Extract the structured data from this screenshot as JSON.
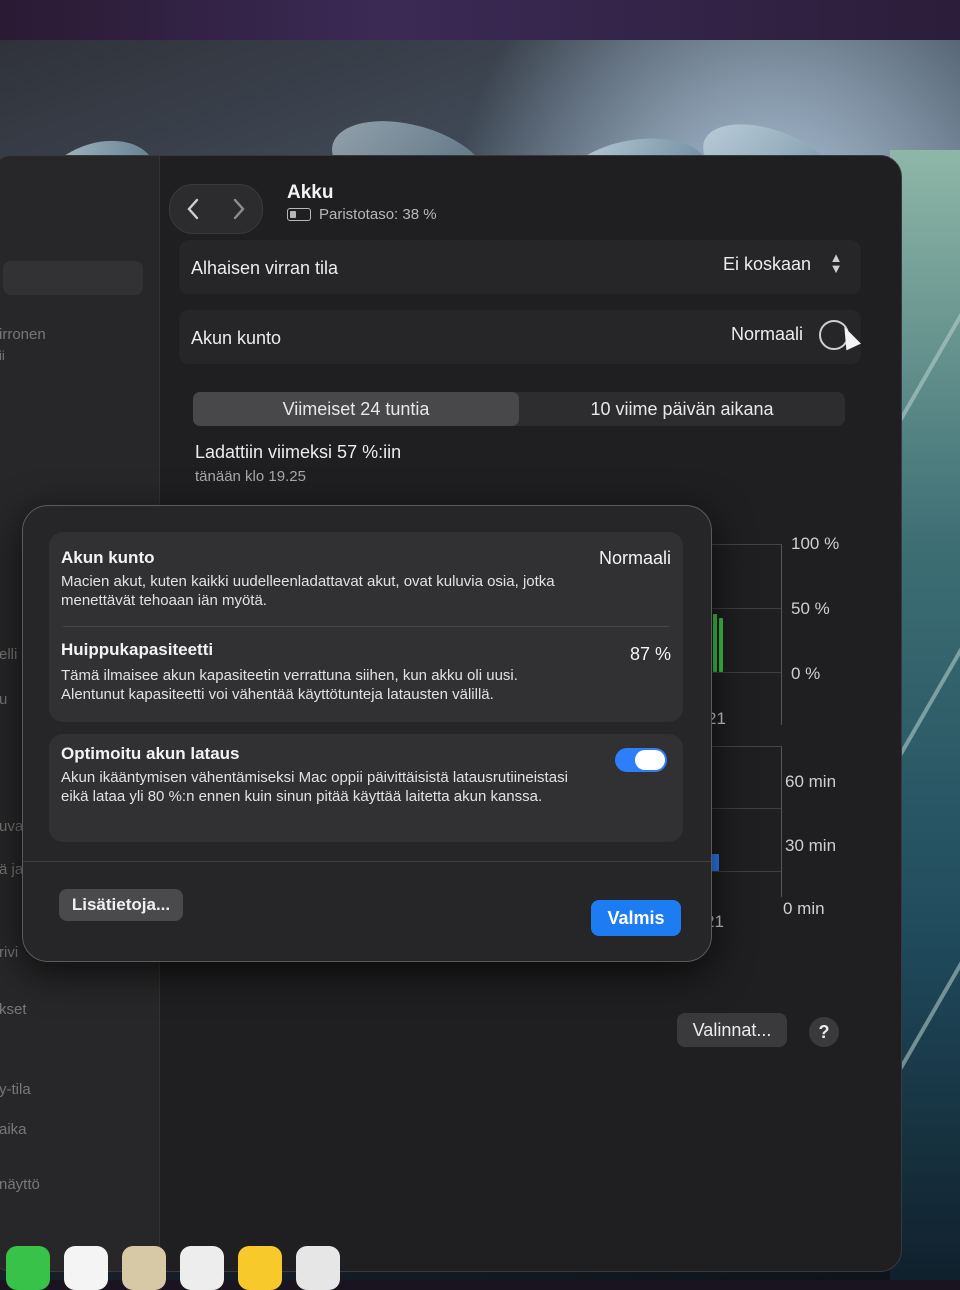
{
  "window": {
    "title": "Akku",
    "battery_status": "Paristotaso: 38 %"
  },
  "sidebar": {
    "items": [
      "irronen",
      "ii",
      "elli",
      "u",
      "uva",
      "ä ja",
      "rivi",
      "kset",
      "y-tila",
      "aika",
      "näyttö"
    ]
  },
  "settings": {
    "low_power": {
      "label": "Alhaisen virran tila",
      "value": "Ei koskaan"
    },
    "battery_health": {
      "label": "Akun kunto",
      "value": "Normaali"
    }
  },
  "tabs": [
    "Viimeiset 24 tuntia",
    "10 viime päivän aikana"
  ],
  "last_charged": {
    "title": "Ladattiin viimeksi 57 %:iin",
    "time": "tänään klo 19.25"
  },
  "chart_data": [
    {
      "type": "bar",
      "title": "",
      "yticks": [
        "100 %",
        "50 %",
        "0 %"
      ],
      "xticks": [
        "21"
      ],
      "ylim": [
        0,
        100
      ],
      "values": [
        40,
        45,
        42
      ]
    },
    {
      "type": "bar",
      "title": "",
      "yticks": [
        "60 min",
        "30 min",
        "0 min"
      ],
      "xticks": [
        "21"
      ],
      "ylim": [
        0,
        60
      ],
      "values": [
        8
      ]
    }
  ],
  "footer": {
    "options_label": "Valinnat...",
    "help_label": "?"
  },
  "sheet": {
    "health": {
      "title": "Akun kunto",
      "value": "Normaali",
      "description": "Macien akut, kuten kaikki uudelleenladattavat akut, ovat kuluvia osia, jotka menettävät tehoaan iän myötä."
    },
    "capacity": {
      "title": "Huippukapasiteetti",
      "value": "87 %",
      "description": "Tämä ilmaisee akun kapasiteetin verrattuna siihen, kun akku oli uusi. Alentunut kapasiteetti voi vähentää käyttötunteja latausten välillä."
    },
    "optimized": {
      "title": "Optimoitu akun lataus",
      "enabled": true,
      "description": "Akun ikääntymisen vähentämiseksi Mac oppii päivittäisistä latausrutiineistasi eikä lataa yli 80 %:n ennen kuin sinun pitää käyttää laitetta akun kanssa."
    },
    "more_info_label": "Lisätietoja...",
    "done_label": "Valmis"
  },
  "colors": {
    "accent": "#1e7cf2",
    "bar_green": "#3ec94a",
    "bar_blue": "#2d7ff9"
  }
}
